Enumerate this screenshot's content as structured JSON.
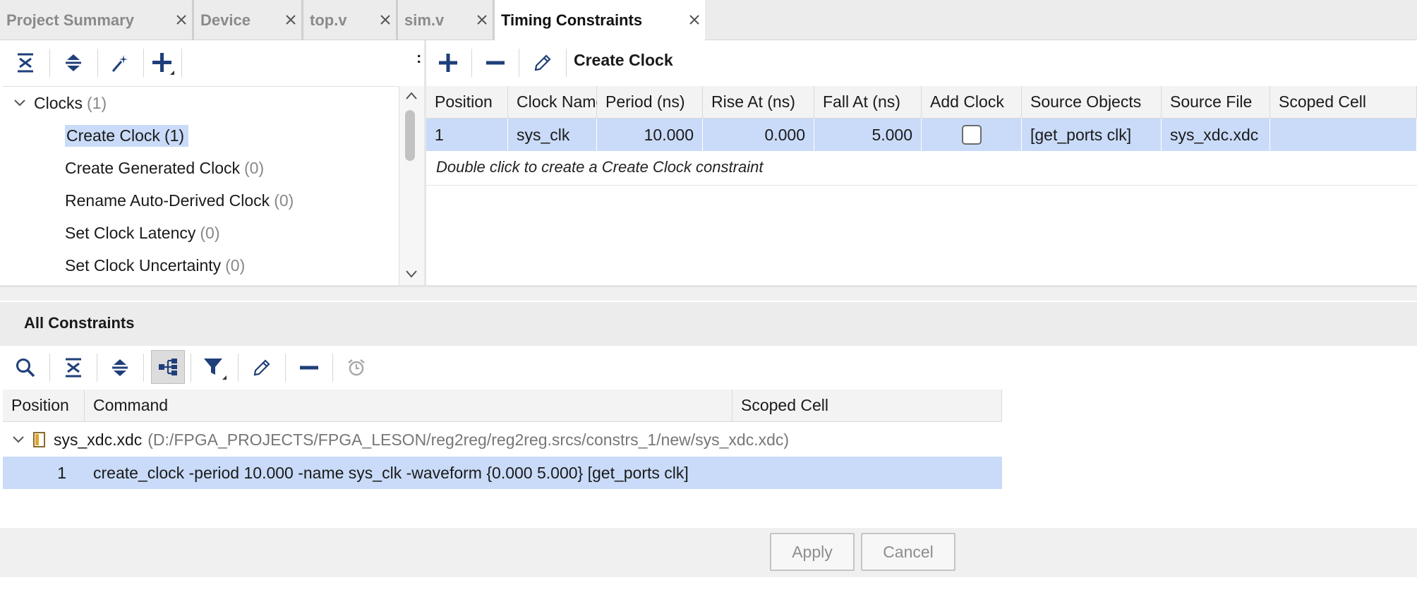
{
  "tabs": [
    {
      "label": "Project Summary"
    },
    {
      "label": "Device"
    },
    {
      "label": "top.v"
    },
    {
      "label": "sim.v"
    },
    {
      "label": "Timing Constraints"
    }
  ],
  "tree": {
    "group": {
      "label": "Clocks",
      "count": "(1)"
    },
    "items": [
      {
        "label": "Create Clock",
        "count": "(1)"
      },
      {
        "label": "Create Generated Clock",
        "count": "(0)"
      },
      {
        "label": "Rename Auto-Derived Clock",
        "count": "(0)"
      },
      {
        "label": "Set Clock Latency",
        "count": "(0)"
      },
      {
        "label": "Set Clock Uncertainty",
        "count": "(0)"
      }
    ]
  },
  "right_pane": {
    "title": "Create Clock",
    "columns": [
      "Position",
      "Clock Name",
      "Period (ns)",
      "Rise At (ns)",
      "Fall At (ns)",
      "Add Clock",
      "Source Objects",
      "Source File",
      "Scoped Cell"
    ],
    "row": {
      "position": "1",
      "clock_name": "sys_clk",
      "period": "10.000",
      "rise_at": "0.000",
      "fall_at": "5.000",
      "add_clock": false,
      "source_objects": "[get_ports clk]",
      "source_file": "sys_xdc.xdc",
      "scoped_cell": ""
    },
    "hint": "Double click to create a Create Clock constraint"
  },
  "all_constraints": {
    "title": "All Constraints",
    "columns": [
      "Position",
      "Command",
      "Scoped Cell"
    ],
    "file": {
      "name": "sys_xdc.xdc",
      "path": "(D:/FPGA_PROJECTS/FPGA_LESON/reg2reg/reg2reg.srcs/constrs_1/new/sys_xdc.xdc)"
    },
    "rows": [
      {
        "position": "1",
        "command": "create_clock -period 10.000 -name sys_clk -waveform {0.000 5.000} [get_ports clk]",
        "scoped_cell": ""
      }
    ]
  },
  "buttons": {
    "apply": "Apply",
    "cancel": "Cancel"
  },
  "colors": {
    "accent": "#1f3f7a",
    "selection": "#c9dbf8"
  }
}
